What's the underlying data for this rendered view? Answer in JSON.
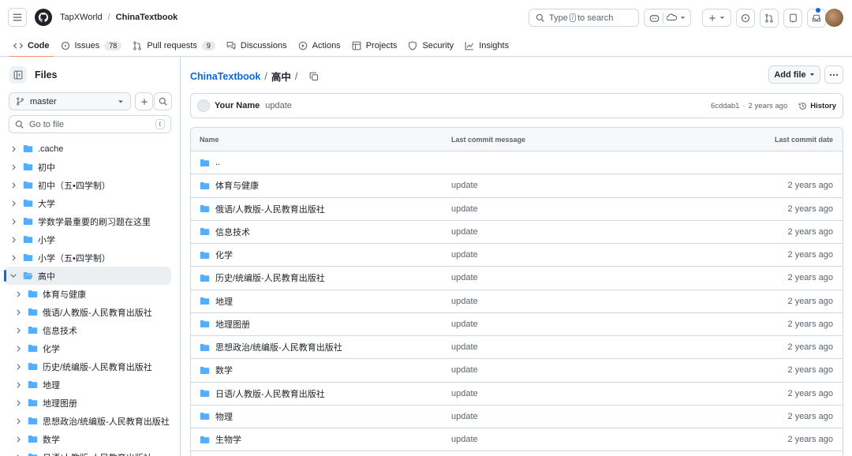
{
  "header": {
    "owner": "TapXWorld",
    "separator": "/",
    "repo": "ChinaTextbook",
    "search_prefix": "Type",
    "search_key": "/",
    "search_suffix": "to search"
  },
  "repo_nav": {
    "tabs": [
      {
        "label": "Code",
        "icon": "code-icon",
        "active": true
      },
      {
        "label": "Issues",
        "icon": "issue-icon",
        "count": "78"
      },
      {
        "label": "Pull requests",
        "icon": "pull-request-icon",
        "count": "9"
      },
      {
        "label": "Discussions",
        "icon": "discussion-icon"
      },
      {
        "label": "Actions",
        "icon": "play-icon"
      },
      {
        "label": "Projects",
        "icon": "table-icon"
      },
      {
        "label": "Security",
        "icon": "shield-icon"
      },
      {
        "label": "Insights",
        "icon": "graph-icon"
      }
    ]
  },
  "sidebar": {
    "title": "Files",
    "branch": "master",
    "goto_placeholder": "Go to file",
    "goto_key": "t",
    "tree": [
      {
        "label": ".cache",
        "level": 0
      },
      {
        "label": "初中",
        "level": 0
      },
      {
        "label": "初中（五•四学制）",
        "level": 0
      },
      {
        "label": "大学",
        "level": 0
      },
      {
        "label": "学数学最重要的刷习题在这里",
        "level": 0
      },
      {
        "label": "小学",
        "level": 0
      },
      {
        "label": "小学（五•四学制）",
        "level": 0
      },
      {
        "label": "高中",
        "level": 0,
        "expanded": true,
        "selected": true
      },
      {
        "label": "体育与健康",
        "level": 1
      },
      {
        "label": "俄语/人教版-人民教育出版社",
        "level": 1
      },
      {
        "label": "信息技术",
        "level": 1
      },
      {
        "label": "化学",
        "level": 1
      },
      {
        "label": "历史/统编版-人民教育出版社",
        "level": 1
      },
      {
        "label": "地理",
        "level": 1
      },
      {
        "label": "地理图册",
        "level": 1
      },
      {
        "label": "思想政治/统编版-人民教育出版社",
        "level": 1
      },
      {
        "label": "数学",
        "level": 1
      },
      {
        "label": "日语/人教版-人民教育出版社",
        "level": 1
      }
    ]
  },
  "main": {
    "path_repo": "ChinaTextbook",
    "path_sep": "/",
    "path_dir": "高中",
    "path_trail": "/",
    "add_file": "Add file",
    "commit": {
      "author": "Your Name",
      "message": "update",
      "hash": "6cddab1",
      "dot": "·",
      "time": "2 years ago",
      "history": "History"
    },
    "table": {
      "headers": [
        "Name",
        "Last commit message",
        "Last commit date"
      ],
      "parent": "..",
      "rows": [
        {
          "name": "体育与健康",
          "msg": "update",
          "date": "2 years ago"
        },
        {
          "name": "俄语/人教版-人民教育出版社",
          "msg": "update",
          "date": "2 years ago"
        },
        {
          "name": "信息技术",
          "msg": "update",
          "date": "2 years ago"
        },
        {
          "name": "化学",
          "msg": "update",
          "date": "2 years ago"
        },
        {
          "name": "历史/统编版-人民教育出版社",
          "msg": "update",
          "date": "2 years ago"
        },
        {
          "name": "地理",
          "msg": "update",
          "date": "2 years ago"
        },
        {
          "name": "地理图册",
          "msg": "update",
          "date": "2 years ago"
        },
        {
          "name": "思想政治/统编版-人民教育出版社",
          "msg": "update",
          "date": "2 years ago"
        },
        {
          "name": "数学",
          "msg": "update",
          "date": "2 years ago"
        },
        {
          "name": "日语/人教版-人民教育出版社",
          "msg": "update",
          "date": "2 years ago"
        },
        {
          "name": "物理",
          "msg": "update",
          "date": "2 years ago"
        },
        {
          "name": "生物学",
          "msg": "update",
          "date": "2 years ago"
        }
      ]
    }
  },
  "colors": {
    "accent": "#0969da",
    "folder": "#54aeff",
    "border": "#d1d9e0",
    "tab_underline": "#fd8c73"
  }
}
